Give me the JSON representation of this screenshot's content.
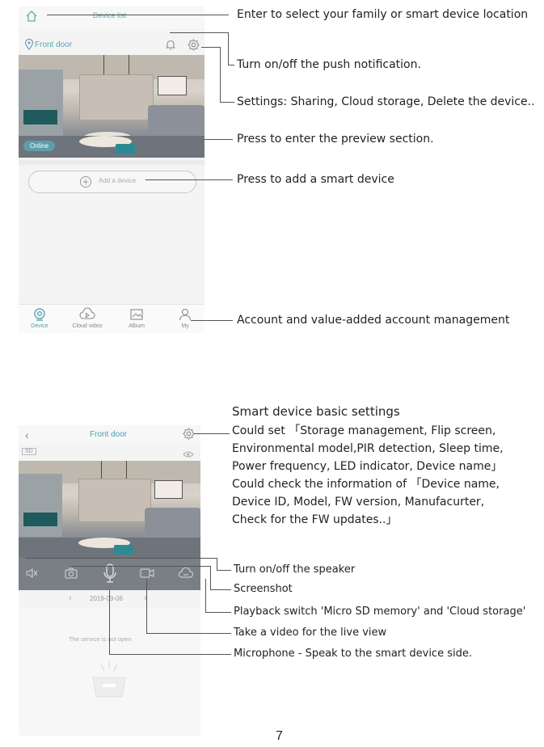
{
  "screen1": {
    "header": {
      "title": "Device list"
    },
    "device_card": {
      "name": "Front door",
      "status": "Online"
    },
    "add_device_label": "Add a device",
    "bottom_nav": [
      {
        "label": "Device"
      },
      {
        "label": "Cloud video"
      },
      {
        "label": "Album"
      },
      {
        "label": "My"
      }
    ]
  },
  "screen2": {
    "header": {
      "title": "Front door"
    },
    "sd_badge": "SD",
    "date": "2019-09-06",
    "service_message": "The service is not open"
  },
  "annotations": {
    "a1": "Enter to select your family or smart device location",
    "a2": "Turn on/off the push notification.",
    "a3": "Settings: Sharing, Cloud storage, Delete the device..",
    "a4": "Press to enter the preview section.",
    "a5": "Press to add a smart device",
    "a6": "Account and value-added account management",
    "basic_title": "Smart device basic settings",
    "basic_lines": [
      "Could set 「Storage management, Flip screen,",
      "Environmental model,PIR detection, Sleep time,",
      "Power frequency, LED indicator, Device name」",
      "Could check the information of 「Device name,",
      "Device ID, Model, FW version, Manufacurter,",
      "Check for the FW updates..」"
    ],
    "speaker": "Turn on/off the speaker",
    "screenshot": "Screenshot",
    "playback": "Playback  switch 'Micro SD memory' and 'Cloud storage'",
    "video": "Take a video for the live view",
    "microphone": "Microphone - Speak to the smart device side."
  },
  "page_number": "7"
}
